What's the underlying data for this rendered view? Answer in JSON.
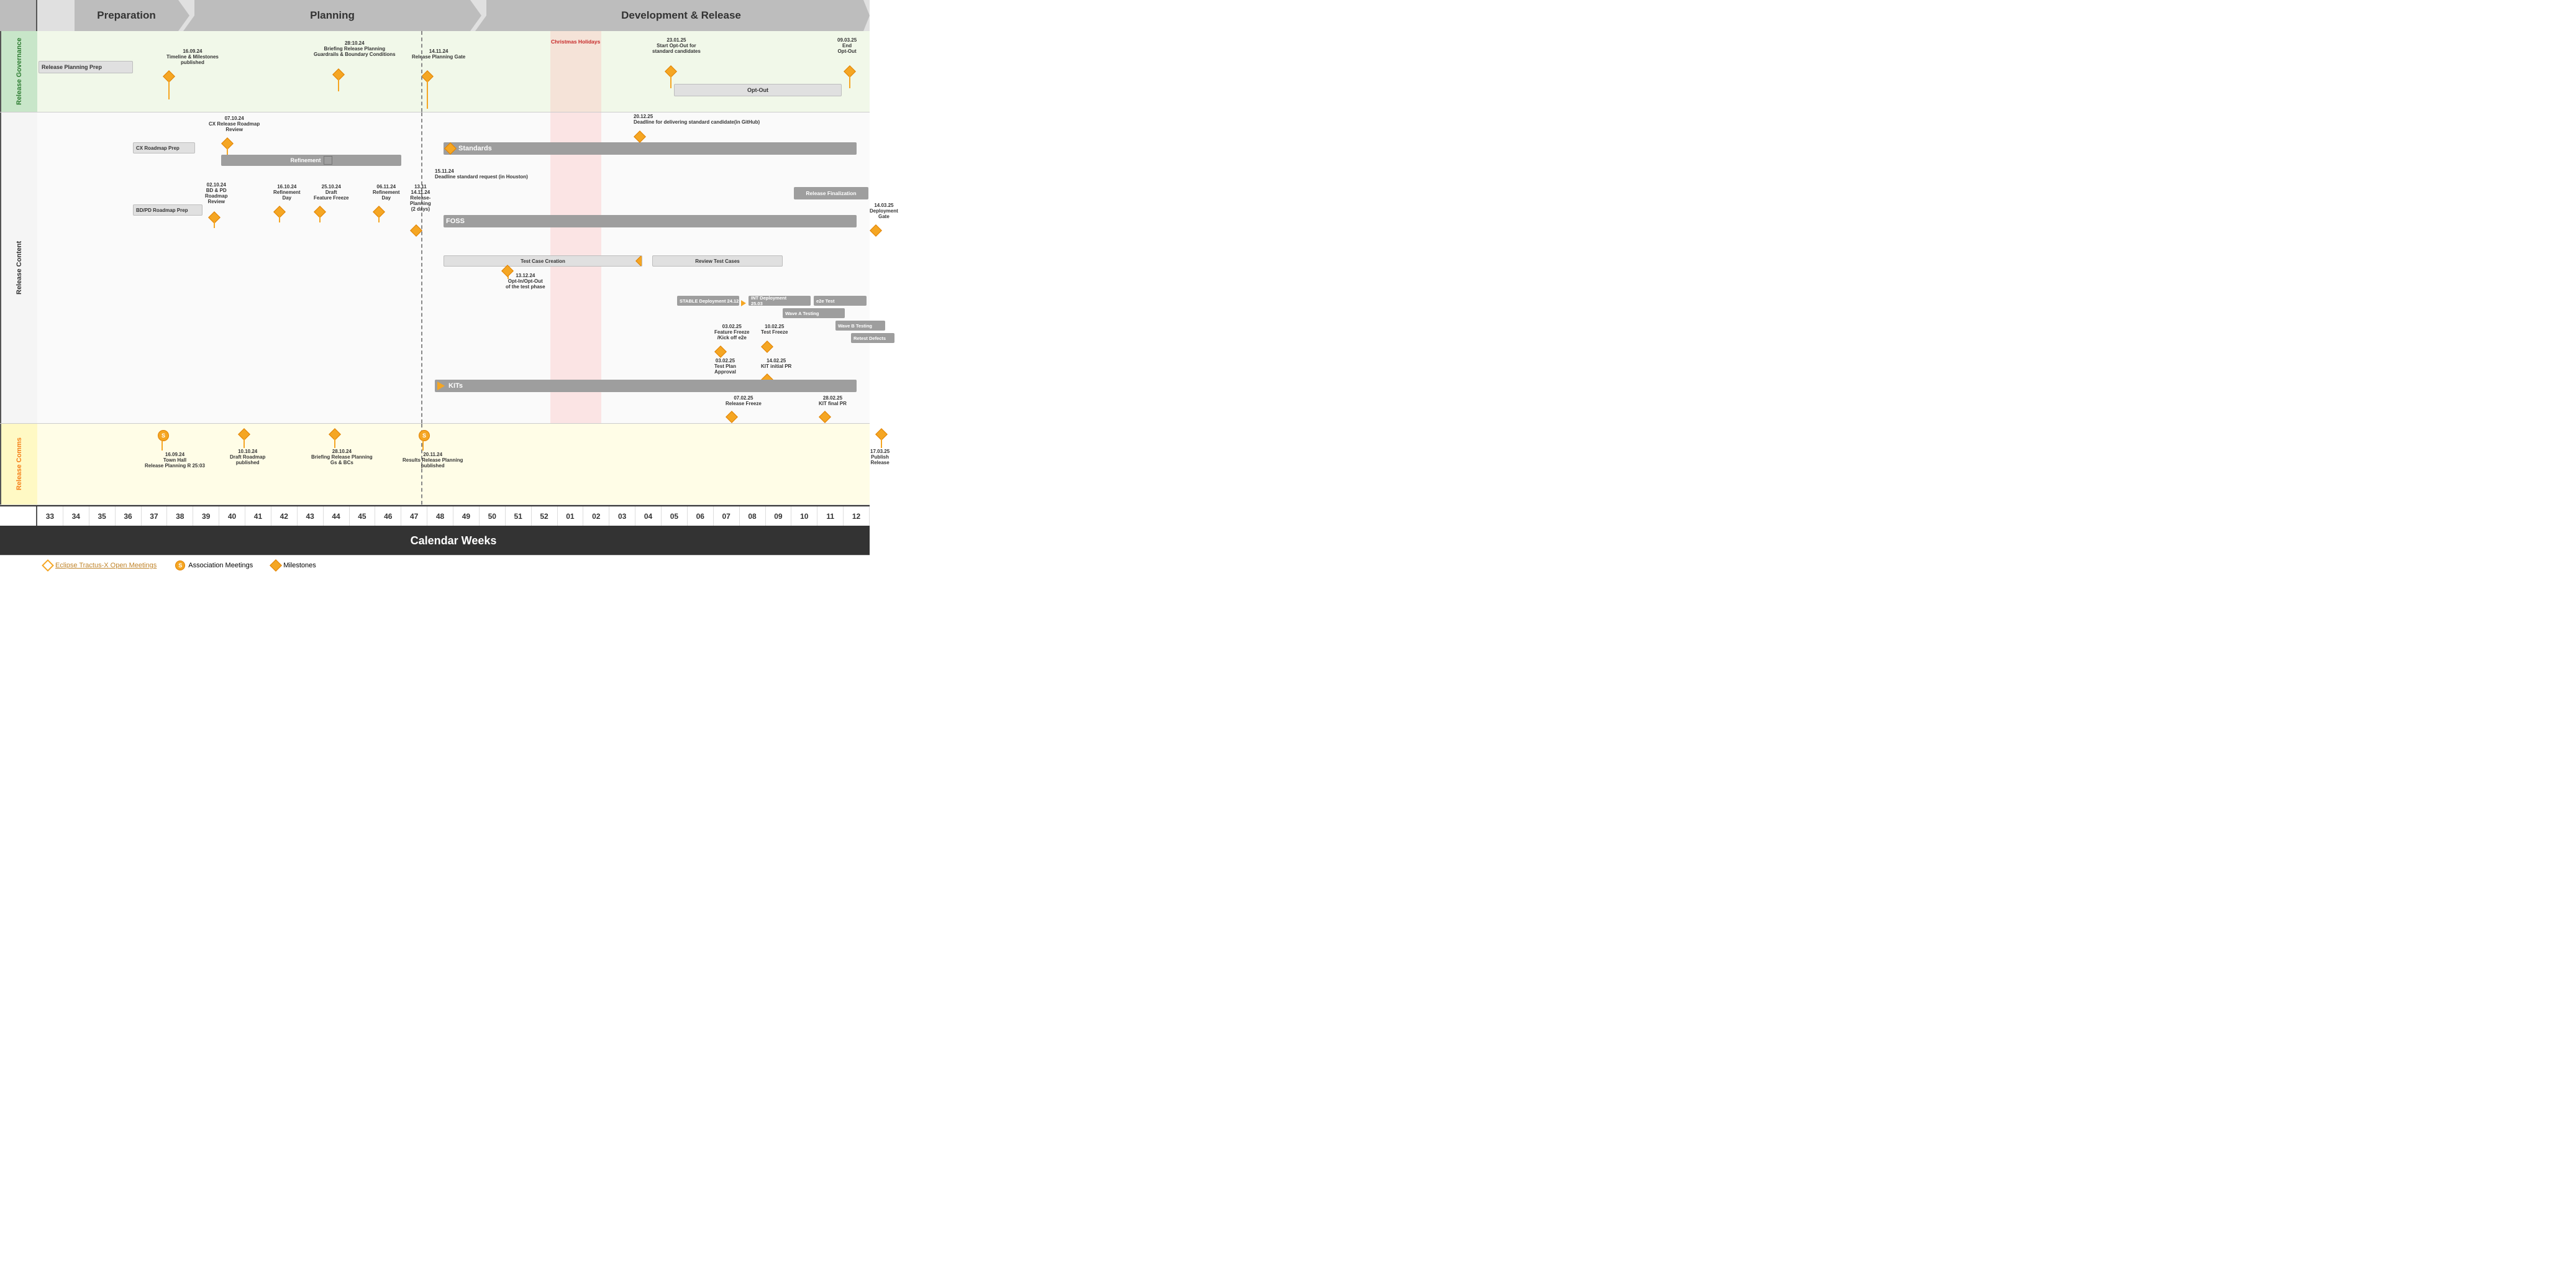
{
  "phases": {
    "preparation": "Preparation",
    "planning": "Planning",
    "devrel": "Development & Release"
  },
  "rows": {
    "governance": "Release Governance",
    "content": "Release Content",
    "comms": "Release Comms"
  },
  "weeks": [
    "33",
    "34",
    "35",
    "36",
    "37",
    "38",
    "39",
    "40",
    "41",
    "42",
    "43",
    "44",
    "45",
    "46",
    "47",
    "48",
    "49",
    "50",
    "51",
    "52",
    "01",
    "02",
    "03",
    "04",
    "05",
    "06",
    "07",
    "08",
    "09",
    "10",
    "11",
    "12"
  ],
  "calendarWeeksLabel": "Calendar Weeks",
  "governance": {
    "items": [
      {
        "label": "Release Planning Prep",
        "type": "bar"
      },
      {
        "label": "16.09.24\nTimeline & Milestones\npublished",
        "type": "milestone"
      },
      {
        "label": "28:10.24\nBriefing Release Planning\nGuardrails & Boundary Conditions",
        "type": "milestone"
      },
      {
        "label": "14.11.24\nRelease Planning Gate",
        "type": "milestone"
      },
      {
        "label": "Christmas Holidays",
        "type": "bar-red"
      },
      {
        "label": "23.01.25\nStart Opt-Out for\nstandard candidates",
        "type": "milestone"
      },
      {
        "label": "Opt-Out",
        "type": "bar"
      },
      {
        "label": "09.03.25\nEnd\nOpt-Out",
        "type": "milestone"
      }
    ]
  },
  "content": {
    "standards": {
      "label": "Standards",
      "deadline": "20.12.25\nDeadline for delivering standard candidate(in GitHub)"
    },
    "foss": {
      "label": "FOSS"
    },
    "kits": {
      "label": "KITs"
    },
    "milestones": [
      "07.10.24\nCX Release Roadmap\nReview",
      "02.10.24\nBD & PD\nRoadmap\nReview",
      "16.10.24\nRefinement\nDay",
      "25.10.24\nDraft\nFeature Freeze",
      "06.11.24\nRefinement\nDay",
      "13.11\n14.11.24\nRelease-\nPlanning\n(2 days)",
      "15.11.24\nDeadline standard request (in Houston)",
      "13.12.24\nOpt-In/Opt-Out\nof the test phase",
      "03.02.25\nFeature Freeze\n/Kick off e2e",
      "10.02.25\nTest Freeze",
      "03.02.25\nTest Plan\nApproval",
      "14.02.25\nKIT initial PR",
      "28.02.25\nKIT final PR",
      "14.03.25\nDeployment\nGate",
      "07.02.25\nRelease Freeze",
      "Release Finalization"
    ]
  },
  "comms": {
    "items": [
      {
        "label": "16.09.24\nTown Hall\nRelease Planning R 25:03"
      },
      {
        "label": "10.10.24\nDraft Roadmap\npublished"
      },
      {
        "label": "28.10.24\nBriefing Release Planning\nGs & BCs"
      },
      {
        "label": "20.11.24\nResults Release Planning\npublished"
      },
      {
        "label": "17.03.25\nPublish\nRelease"
      }
    ]
  },
  "legend": {
    "openMeetings": "Eclipse Tractus-X Open Meetings",
    "associationMeetings": "Association Meetings",
    "milestones": "Milestones"
  }
}
